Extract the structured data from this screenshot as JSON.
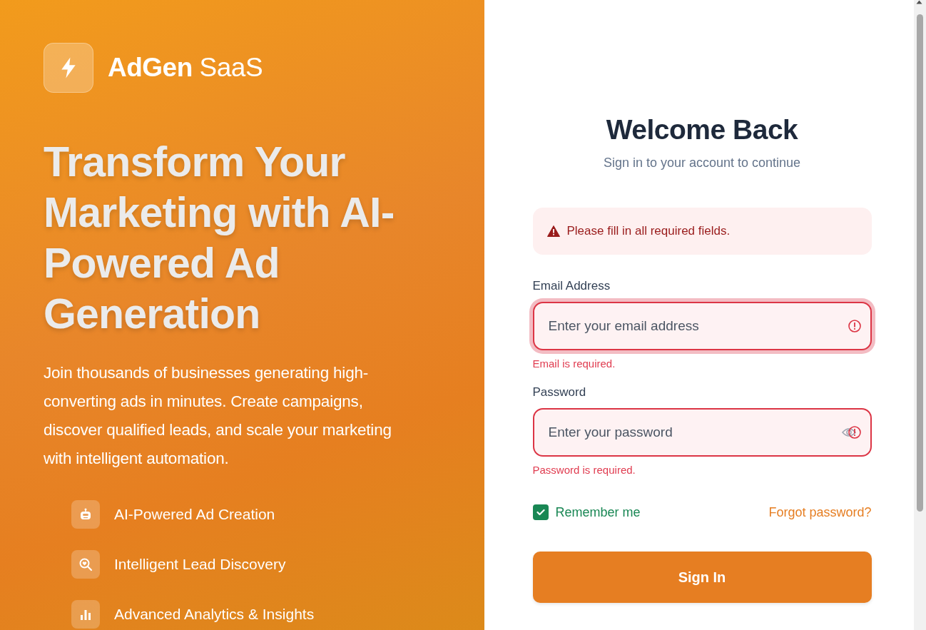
{
  "brand": {
    "name_bold": "AdGen",
    "name_light": "SaaS"
  },
  "hero": {
    "headline": "Transform Your Marketing with AI-Powered Ad Generation",
    "description": "Join thousands of businesses generating high-converting ads in minutes. Create campaigns, discover qualified leads, and scale your marketing with intelligent automation."
  },
  "features": [
    {
      "kind": "robot",
      "label": "AI-Powered Ad Creation"
    },
    {
      "kind": "search",
      "label": "Intelligent Lead Discovery"
    },
    {
      "kind": "chart",
      "label": "Advanced Analytics & Insights"
    }
  ],
  "form": {
    "title": "Welcome Back",
    "subtitle": "Sign in to your account to continue",
    "alert": "Please fill in all required fields.",
    "fields": [
      {
        "kind": "email",
        "label": "Email Address",
        "placeholder": "Enter your email address",
        "invalid": true,
        "focused": true,
        "error": "Email is required."
      },
      {
        "kind": "password",
        "label": "Password",
        "placeholder": "Enter your password",
        "invalid": true,
        "focused": false,
        "error": "Password is required."
      }
    ],
    "remember": {
      "label": "Remember me",
      "checked": true
    },
    "forgot_link": "Forgot password?",
    "submit": "Sign In"
  }
}
